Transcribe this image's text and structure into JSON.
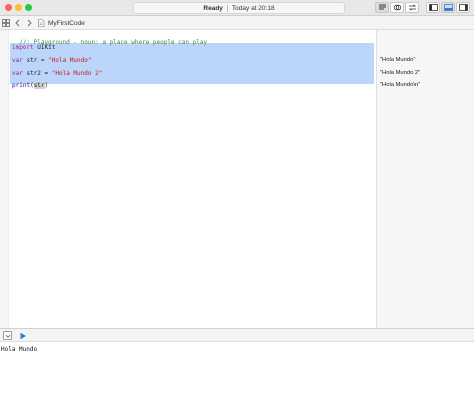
{
  "window": {
    "status": {
      "state": "Ready",
      "timestamp": "Today at 20:18"
    }
  },
  "jumpbar": {
    "file_name": "MyFirstCode"
  },
  "editor": {
    "lines": [
      {
        "comment": "//: Playground - noun: a place where people can play"
      },
      {
        "kw": "import",
        "rest": " UIKit"
      },
      {
        "kw": "var",
        "rest": " str = ",
        "str": "\"Hola Mundo\""
      },
      {
        "kw": "var",
        "rest": " str2 = ",
        "str": "\"Hola Mundo 2\""
      },
      {
        "fn": "print",
        "open": "(",
        "arg": "str",
        "close": ")"
      }
    ]
  },
  "results": [
    "\"Hola Mundo\"",
    "\"Hola Mundo 2\"",
    "\"Hola Mundo\\n\""
  ],
  "console": {
    "output": "Hola Mundo"
  },
  "colors": {
    "selection": "#bcd6fb",
    "keyword": "#9b2393",
    "string": "#c41a16",
    "comment": "#3a8d3a",
    "run_button": "#2f7be5"
  }
}
